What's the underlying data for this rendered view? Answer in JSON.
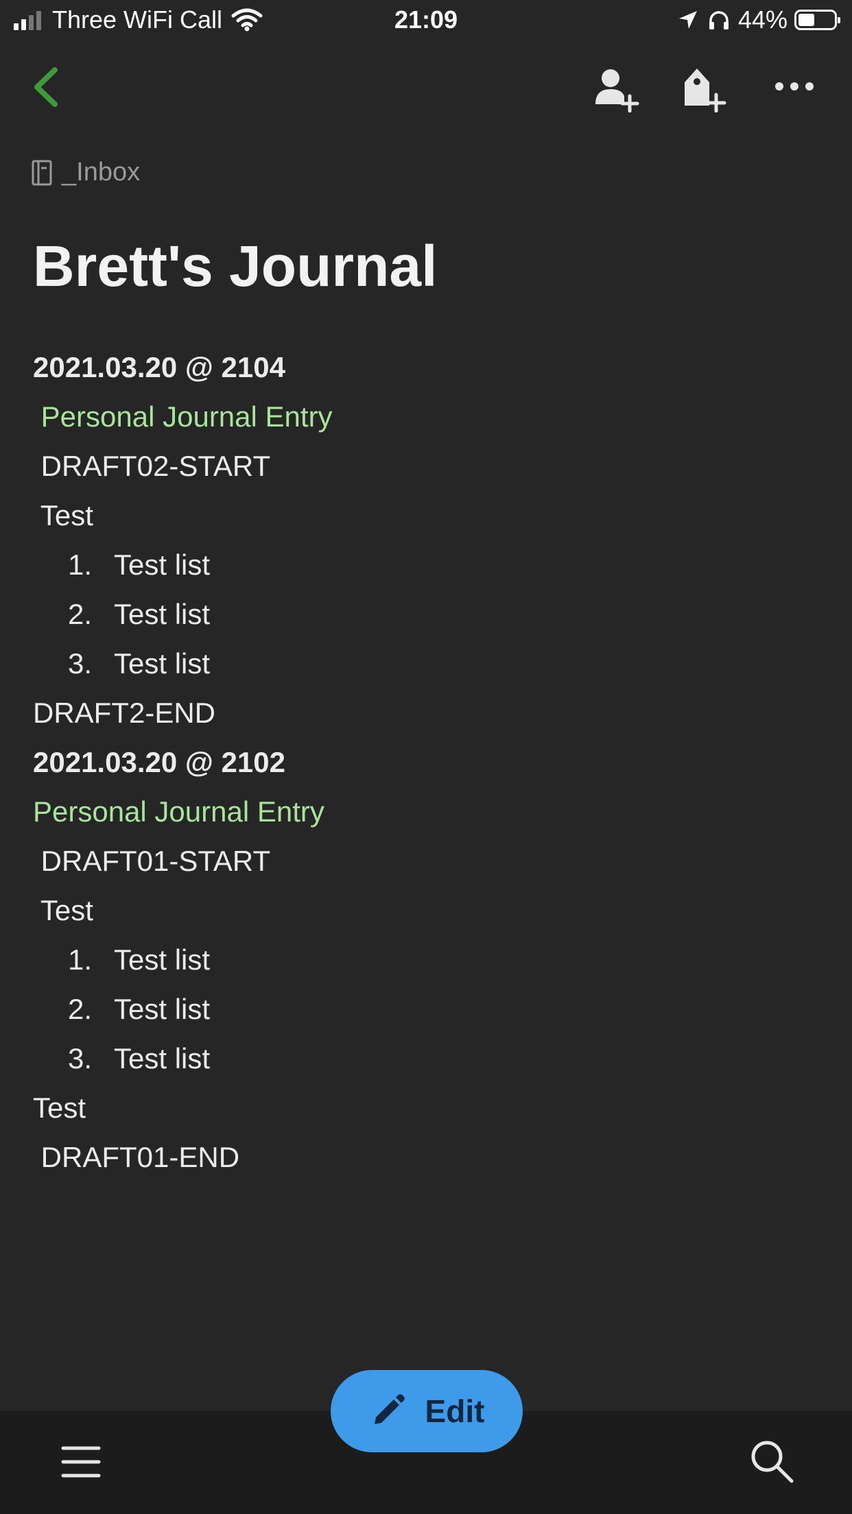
{
  "status_bar": {
    "carrier": "Three WiFi Call",
    "time": "21:09",
    "battery": "44%",
    "battery_level": 0.44
  },
  "nav": {
    "back_icon": "chevron-left-icon",
    "share_icon": "add-person-icon",
    "tag_icon": "add-tag-icon",
    "more_icon": "more-horizontal-icon"
  },
  "notebook": {
    "name": "_Inbox"
  },
  "note": {
    "title": "Brett's Journal",
    "entries": [
      {
        "date": "2021.03.20 @ 2104",
        "category": " Personal Journal Entry",
        "start": " DRAFT02-START",
        "text": " Test",
        "list": [
          {
            "num": "1.",
            "text": "Test list"
          },
          {
            "num": "2.",
            "text": "Test list"
          },
          {
            "num": "3.",
            "text": "Test list"
          }
        ],
        "end": "DRAFT2-END"
      },
      {
        "date": "2021.03.20 @ 2102",
        "category": "Personal Journal Entry",
        "start": " DRAFT01-START",
        "text": " Test",
        "list": [
          {
            "num": "1.",
            "text": "Test list"
          },
          {
            "num": "2.",
            "text": "Test list"
          },
          {
            "num": "3.",
            "text": "Test list"
          }
        ],
        "trailing": "Test",
        "end": " DRAFT01-END"
      }
    ]
  },
  "edit_button": {
    "label": "Edit"
  },
  "colors": {
    "accent_green": "#3e9a3a",
    "entry_green": "#a8e59a",
    "edit_blue": "#3d9be9",
    "background": "#262626"
  }
}
